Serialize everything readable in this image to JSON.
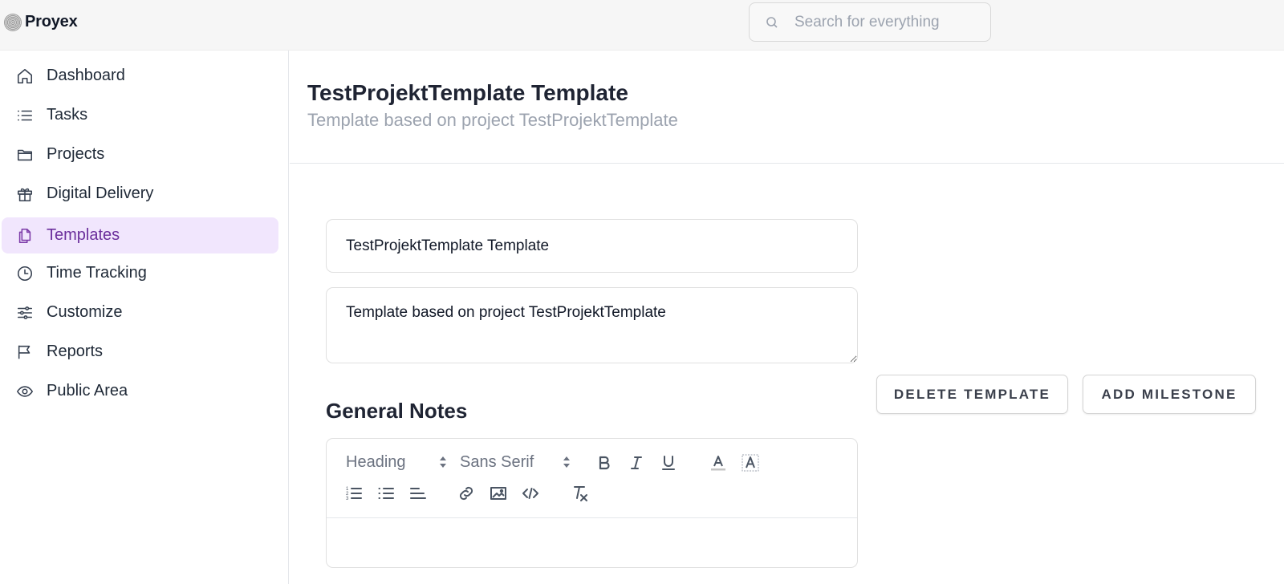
{
  "app": {
    "name": "Proyex"
  },
  "search": {
    "placeholder": "Search for everything"
  },
  "sidebar": {
    "items": [
      {
        "label": "Dashboard",
        "icon": "home-icon"
      },
      {
        "label": "Tasks",
        "icon": "list-icon"
      },
      {
        "label": "Projects",
        "icon": "folder-icon"
      },
      {
        "label": "Digital Delivery",
        "icon": "gift-icon"
      },
      {
        "label": "Templates",
        "icon": "documents-icon",
        "active": true
      },
      {
        "label": "Time Tracking",
        "icon": "clock-icon"
      },
      {
        "label": "Customize",
        "icon": "sliders-icon"
      },
      {
        "label": "Reports",
        "icon": "flag-icon"
      },
      {
        "label": "Public Area",
        "icon": "eye-icon"
      }
    ]
  },
  "header": {
    "title": "TestProjektTemplate Template",
    "subtitle": "Template based on project TestProjektTemplate"
  },
  "form": {
    "name_value": "TestProjektTemplate Template",
    "description_value": "Template based on project TestProjektTemplate"
  },
  "actions": {
    "delete_label": "DELETE TEMPLATE",
    "add_milestone_label": "ADD MILESTONE"
  },
  "notes": {
    "heading": "General Notes",
    "editor": {
      "header_select": "Heading",
      "font_select": "Sans Serif",
      "body_value": ""
    }
  },
  "colors": {
    "accent": "#6b2f9c",
    "active_bg": "#f1e6fd"
  }
}
